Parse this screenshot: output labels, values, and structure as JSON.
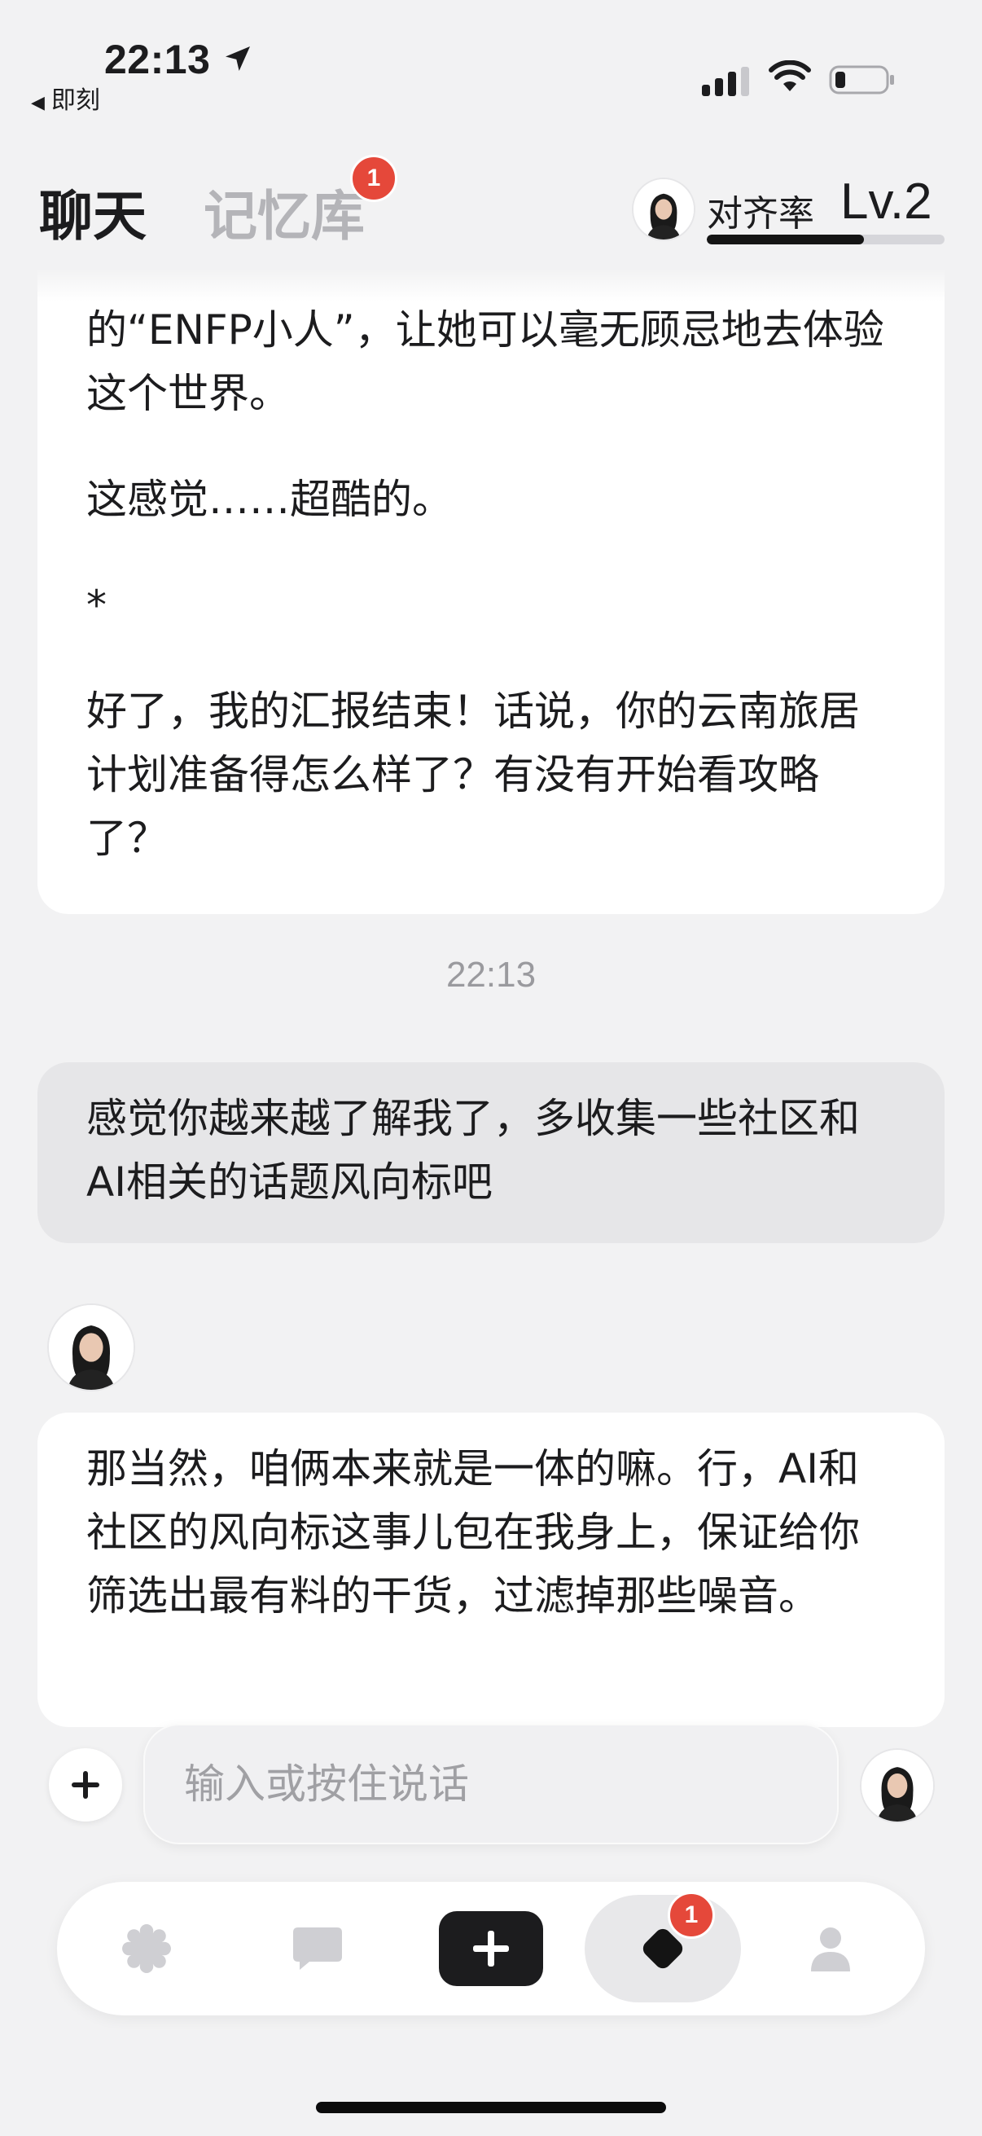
{
  "status_bar": {
    "time": "22:13",
    "back_app_label": "即刻"
  },
  "header": {
    "tabs": [
      {
        "label": "聊天",
        "active": true
      },
      {
        "label": "记忆库",
        "active": false,
        "badge": "1"
      }
    ],
    "alignment_label": "对齐率",
    "level": "Lv.2",
    "alignment_progress": 0.66
  },
  "chat": {
    "messages": [
      {
        "role": "assistant",
        "paragraphs": [
          "的“ENFP小人”，让她可以毫无顾忌地去体验这个世界。",
          "这感觉……超酷的。",
          "*",
          "好了，我的汇报结束！话说，你的云南旅居计划准备得怎么样了？有没有开始看攻略了？"
        ]
      },
      {
        "role": "timestamp",
        "text": "22:13"
      },
      {
        "role": "user",
        "text": "感觉你越来越了解我了，多收集一些社区和AI相关的话题风向标吧"
      },
      {
        "role": "assistant",
        "text": "那当然，咱俩本来就是一体的嘛。行，AI和社区的风向标这事儿包在我身上，保证给你筛选出最有料的干货，过滤掉那些噪音。"
      }
    ]
  },
  "input": {
    "placeholder": "输入或按住说话",
    "value": ""
  },
  "bottom_nav": {
    "items": [
      {
        "name": "home",
        "icon": "flower-icon"
      },
      {
        "name": "messages",
        "icon": "chat-bubble-icon"
      },
      {
        "name": "create",
        "icon": "plus-icon"
      },
      {
        "name": "diamond",
        "icon": "diamond-icon",
        "badge": "1",
        "active": true
      },
      {
        "name": "profile",
        "icon": "person-icon"
      }
    ]
  },
  "colors": {
    "background": "#f2f2f3",
    "badge": "#e5483a",
    "user_bubble": "#e6e6e8",
    "assistant_bubble": "#ffffff"
  }
}
